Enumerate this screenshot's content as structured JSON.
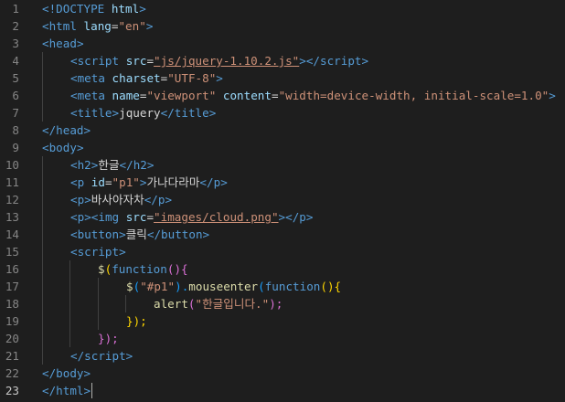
{
  "editor": {
    "language": "html",
    "active_line": 23,
    "line_numbers": [
      "1",
      "2",
      "3",
      "4",
      "5",
      "6",
      "7",
      "8",
      "9",
      "10",
      "11",
      "12",
      "13",
      "14",
      "15",
      "16",
      "17",
      "18",
      "19",
      "20",
      "21",
      "22",
      "23"
    ],
    "lines": [
      [
        "<!",
        "DOCTYPE",
        " ",
        "html",
        ">"
      ],
      [
        "<",
        "html",
        " ",
        "lang",
        "=",
        "\"en\"",
        ">"
      ],
      [
        "<",
        "head",
        ">"
      ],
      [
        "<",
        "script",
        " ",
        "src",
        "=",
        "\"js/jquery-1.10.2.js\"",
        "></",
        "script",
        ">"
      ],
      [
        "<",
        "meta",
        " ",
        "charset",
        "=",
        "\"UTF-8\"",
        ">"
      ],
      [
        "<",
        "meta",
        " ",
        "name",
        "=",
        "\"viewport\"",
        " ",
        "content",
        "=",
        "\"width=device-width, initial-scale=1.0\"",
        ">"
      ],
      [
        "<",
        "title",
        ">",
        "jquery",
        "</",
        "title",
        ">"
      ],
      [
        "</",
        "head",
        ">"
      ],
      [
        "<",
        "body",
        ">"
      ],
      [
        "<",
        "h2",
        ">",
        "한글",
        "</",
        "h2",
        ">"
      ],
      [
        "<",
        "p",
        " ",
        "id",
        "=",
        "\"p1\"",
        ">",
        "가나다라마",
        "</",
        "p",
        ">"
      ],
      [
        "<",
        "p",
        ">",
        "바사아자차",
        "</",
        "p",
        ">"
      ],
      [
        "<",
        "p",
        "><",
        "img",
        " ",
        "src",
        "=",
        "\"images/cloud.png\"",
        "></",
        "p",
        ">"
      ],
      [
        "<",
        "button",
        ">",
        "클릭",
        "</",
        "button",
        ">"
      ],
      [
        "<",
        "script",
        ">"
      ],
      [
        "$",
        "(",
        "function",
        "(){"
      ],
      [
        "$",
        "(",
        "\"#p1\"",
        ").",
        "mouseenter",
        "(",
        "function",
        "(){"
      ],
      [
        "alert",
        "(",
        "\"한글입니다.\"",
        ");"
      ],
      [
        "});"
      ],
      [
        "});"
      ],
      [
        "</",
        "script",
        ">"
      ],
      [
        "</",
        "body",
        ">"
      ],
      [
        "</",
        "html",
        ">"
      ]
    ]
  }
}
